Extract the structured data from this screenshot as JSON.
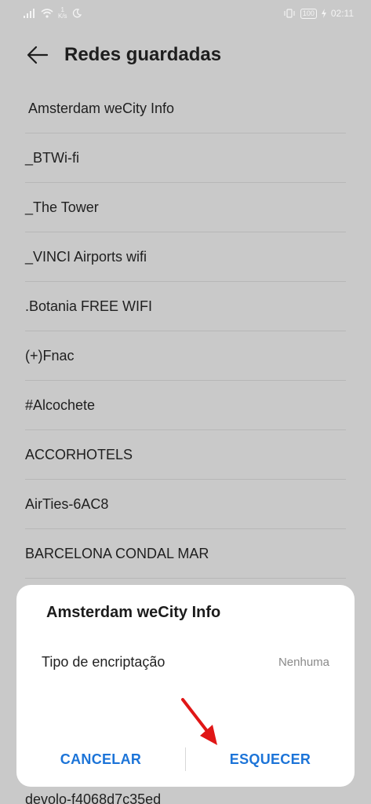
{
  "status_bar": {
    "speed_value": "1",
    "speed_unit": "K/s",
    "battery": "100",
    "time": "02:11"
  },
  "header": {
    "title": "Redes guardadas"
  },
  "networks": [
    "Amsterdam weCity Info",
    "_BTWi-fi",
    "_The Tower",
    "_VINCI Airports wifi",
    ".Botania FREE WIFI",
    "(+)Fnac",
    "#Alcochete",
    "ACCORHOTELS",
    "AirTies-6AC8",
    "BARCELONA CONDAL MAR"
  ],
  "bottom_peek": "devolo-f4068d7c35ed",
  "dialog": {
    "title": "Amsterdam weCity Info",
    "row_label": "Tipo de encriptação",
    "row_value": "Nenhuma",
    "cancel_label": "CANCELAR",
    "forget_label": "ESQUECER"
  },
  "colors": {
    "accent": "#1c74d8",
    "arrow": "#e01616",
    "scrim": "#c9c9c9"
  }
}
